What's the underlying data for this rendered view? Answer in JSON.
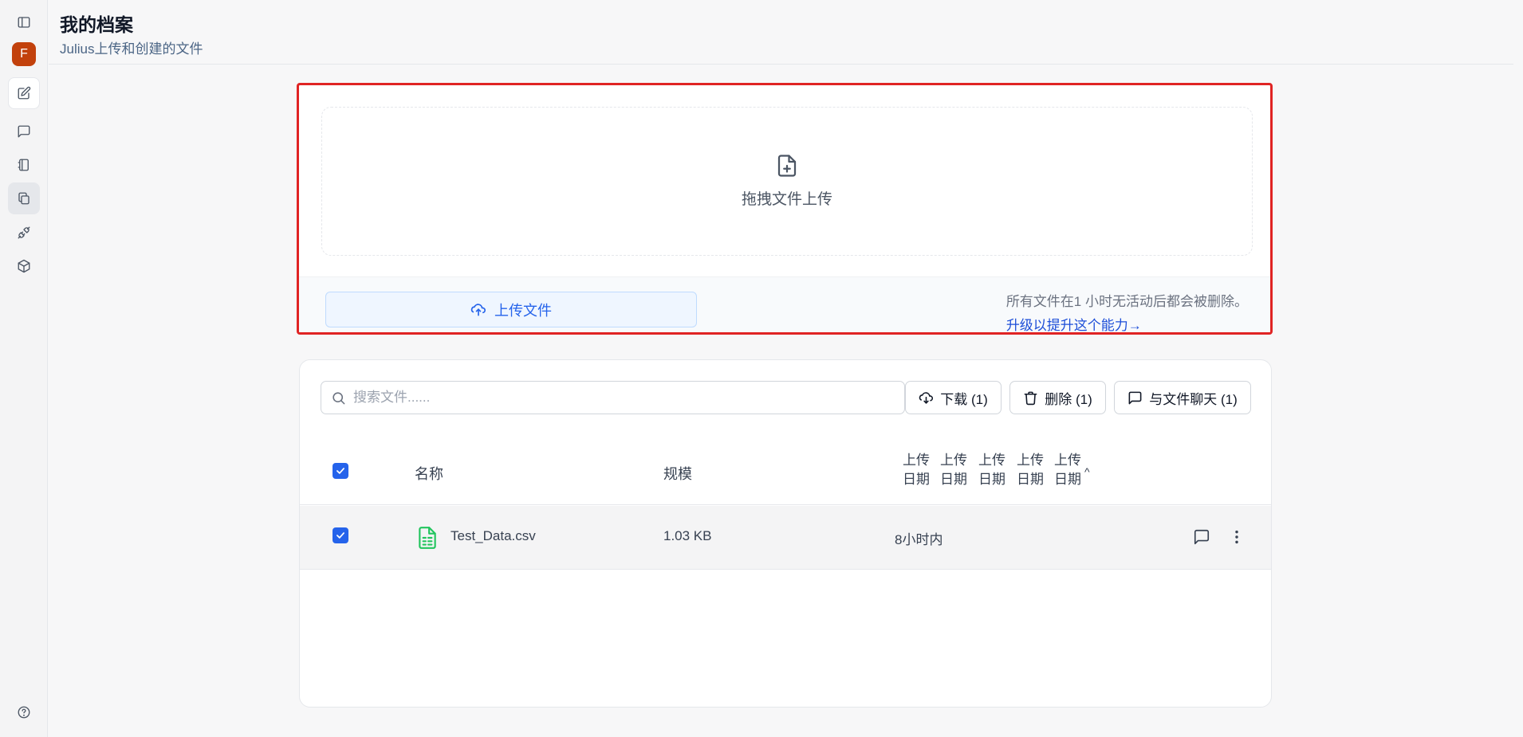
{
  "sidebar": {
    "avatar_letter": "F",
    "icons": [
      "sidebar-toggle-icon",
      "new-chat-icon",
      "chat-icon",
      "notebook-icon",
      "files-icon",
      "plug-icon",
      "cube-icon",
      "help-icon"
    ]
  },
  "header": {
    "title": "我的档案",
    "subtitle": "Julius上传和创建的文件"
  },
  "upload": {
    "drop_label": "拖拽文件上传",
    "button_label": "上传文件",
    "notice": "所有文件在1 小时无活动后都会被删除。",
    "upgrade_link": "升级以提升这个能力→"
  },
  "files": {
    "search_placeholder": "搜索文件......",
    "download_label": "下载 (1)",
    "delete_label": "删除 (1)",
    "chat_label": "与文件聊天 (1)",
    "columns": {
      "name": "名称",
      "size": "规模",
      "date": [
        "上传日期",
        "上传日期",
        "上传日期",
        "上传日期",
        "上传日期"
      ]
    },
    "rows": [
      {
        "name": "Test_Data.csv",
        "size": "1.03 KB",
        "uploaded": "8小时内",
        "selected": true
      }
    ]
  },
  "colors": {
    "accent": "#2563eb",
    "highlight_border": "#e02424",
    "avatar": "#c2410c",
    "csv_icon": "#22c55e"
  }
}
